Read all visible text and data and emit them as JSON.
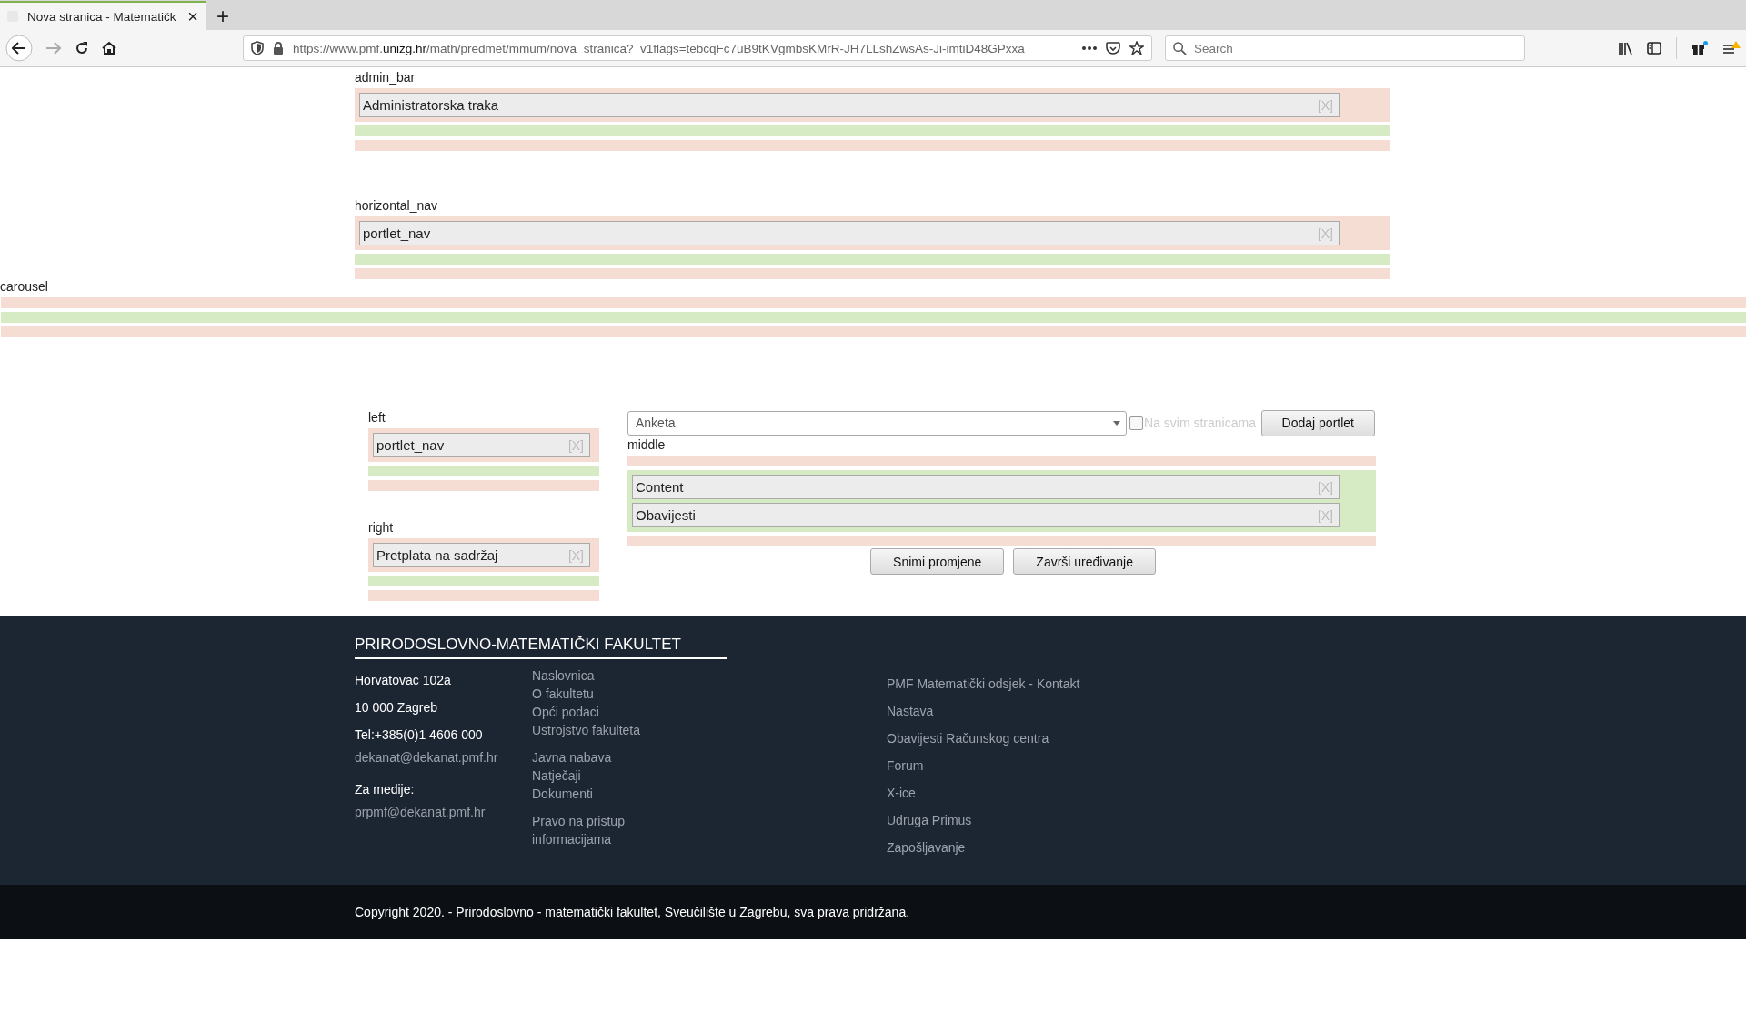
{
  "browser": {
    "tab_title": "Nova stranica - Matematičk",
    "tab_close": "×",
    "new_tab": "+",
    "url": {
      "before": "https://www.pmf.",
      "domain": "unizg.hr",
      "after": "/math/predmet/mmum/nova_stranica?_v1flags=tebcqFc7uB9tKVgmbsKMrR-JH7LLshZwsAs-Ji-imtiD48GPxxa"
    },
    "search_placeholder": "Search"
  },
  "top_regions": [
    {
      "name": "admin_bar",
      "zones": [
        {
          "color": "#f6ddd4",
          "portlets": [
            {
              "label": "Administratorska traka",
              "remove": "[X]"
            }
          ]
        },
        {
          "color": "#d6eac4"
        },
        {
          "color": "#f6ddd4"
        }
      ]
    },
    {
      "name": "horizontal_nav",
      "zones": [
        {
          "color": "#f6ddd4",
          "portlets": [
            {
              "label": "portlet_nav",
              "remove": "[X]"
            }
          ]
        },
        {
          "color": "#d6eac4"
        },
        {
          "color": "#f6ddd4"
        }
      ]
    }
  ],
  "carousel": {
    "name": "carousel",
    "zones": [
      {
        "color": "#f6ddd4"
      },
      {
        "color": "#d6eac4"
      },
      {
        "color": "#f6ddd4"
      }
    ]
  },
  "side_regions": [
    {
      "name": "left",
      "zones": [
        {
          "color": "#f6ddd4",
          "portlets": [
            {
              "label": "portlet_nav",
              "remove": "[X]"
            }
          ]
        },
        {
          "color": "#d6eac4"
        },
        {
          "color": "#f6ddd4"
        }
      ]
    },
    {
      "name": "right",
      "zones": [
        {
          "color": "#f6ddd4",
          "portlets": [
            {
              "label": "Pretplata na sadržaj",
              "remove": "[X]"
            }
          ]
        },
        {
          "color": "#d6eac4"
        },
        {
          "color": "#f6ddd4"
        }
      ]
    }
  ],
  "add_portlet": {
    "select_value": "Anketa",
    "all_pages": {
      "label": "Na svim stranicama",
      "checked": false
    },
    "button": "Dodaj portlet"
  },
  "middle": {
    "name": "middle",
    "zones": [
      {
        "color": "#f6ddd4"
      },
      {
        "color": "#d6eac4",
        "portlets": [
          {
            "label": "Content",
            "remove": "[X]"
          },
          {
            "label": "Obavijesti",
            "remove": "[X]"
          }
        ]
      },
      {
        "color": "#f6ddd4"
      }
    ]
  },
  "actions": [
    "Snimi promjene",
    "Završi uređivanje"
  ],
  "footer": {
    "title": "PRIRODOSLOVNO-MATEMATIČKI FAKULTET",
    "contact_groups": [
      [
        {
          "kind": "text",
          "text": "Horvatovac 102a"
        },
        {
          "kind": "text",
          "text": "10 000 Zagreb"
        },
        {
          "kind": "text",
          "text": "Tel:+385(0)1 4606 000"
        },
        {
          "kind": "link",
          "text": "dekanat@dekanat.pmf.hr"
        }
      ],
      [
        {
          "kind": "text",
          "text": "Za medije:"
        },
        {
          "kind": "link",
          "text": "prpmf@dekanat.pmf.hr"
        }
      ]
    ],
    "link_groups": [
      [
        "Naslovnica",
        "O fakultetu",
        "Opći podaci",
        "Ustrojstvo fakulteta"
      ],
      [
        "Javna nabava",
        "Natječaji",
        "Dokumenti"
      ],
      [
        "Pravo na pristup informacijama"
      ]
    ],
    "links": [
      "PMF Matematički odsjek - Kontakt",
      "Nastava",
      "Obavijesti Računskog centra",
      "Forum",
      "X-ice",
      "Udruga Primus",
      "Zapošljavanje"
    ],
    "copyright": "Copyright 2020. - Prirodoslovno - matematički fakultet, Sveučilište u Zagrebu, sva prava pridržana."
  }
}
